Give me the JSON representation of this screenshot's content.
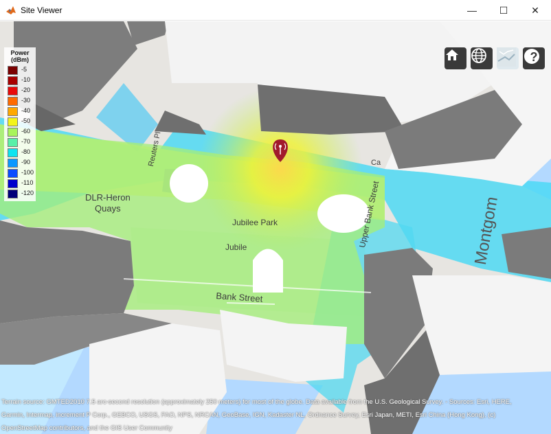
{
  "window": {
    "title": "Site Viewer",
    "minimize": "—",
    "maximize": "☐",
    "close": "✕"
  },
  "toolbar": {
    "home_icon": "home-icon",
    "globe_icon": "globe-icon",
    "basemap_icon": "basemap-icon",
    "help_icon": "help-icon",
    "help_glyph": "?"
  },
  "legend": {
    "title_line1": "Power",
    "title_line2": "(dBm)",
    "items": [
      {
        "label": "-5",
        "color": "#7a0000"
      },
      {
        "label": "-10",
        "color": "#a80000"
      },
      {
        "label": "-20",
        "color": "#e80a0a"
      },
      {
        "label": "-30",
        "color": "#ff6a00"
      },
      {
        "label": "-40",
        "color": "#ffa800"
      },
      {
        "label": "-50",
        "color": "#f4f41a"
      },
      {
        "label": "-60",
        "color": "#a8f45a"
      },
      {
        "label": "-70",
        "color": "#58f0a8"
      },
      {
        "label": "-80",
        "color": "#0ee4f0"
      },
      {
        "label": "-90",
        "color": "#0a98ff"
      },
      {
        "label": "-100",
        "color": "#0a4cff"
      },
      {
        "label": "-110",
        "color": "#0000cc"
      },
      {
        "label": "-120",
        "color": "#00007a"
      }
    ]
  },
  "map_labels": {
    "dlr_line1": "DLR-Heron",
    "dlr_line2": "Quays",
    "park": "Jubilee Park",
    "park2": "Jubile",
    "bank": "Bank Street",
    "upper_bank": "Upper Bank Street",
    "reuters": "Reuters Pl",
    "montgomery": "Montgom",
    "ca": "Ca"
  },
  "transmitter": {
    "icon": "antenna-marker-icon",
    "color": "#a11a2c"
  },
  "attribution": {
    "line1": "Terrain source: GMTED2010 7.5 arc-second resolution (approximately 250 meters) for most of the globe. Data available from the U.S. Geological Survey. - Sources: Esri, HERE,",
    "line2": "Garmin, Intermap, increment P Corp., GEBCO, USGS, FAO, NPS, NRCAN, GeoBase, IGN, Kadaster NL, Ordnance Survey, Esri Japan, METI, Esri China (Hong Kong), (c)",
    "line3": "OpenStreetMap contributors, and the GIS User Community"
  }
}
